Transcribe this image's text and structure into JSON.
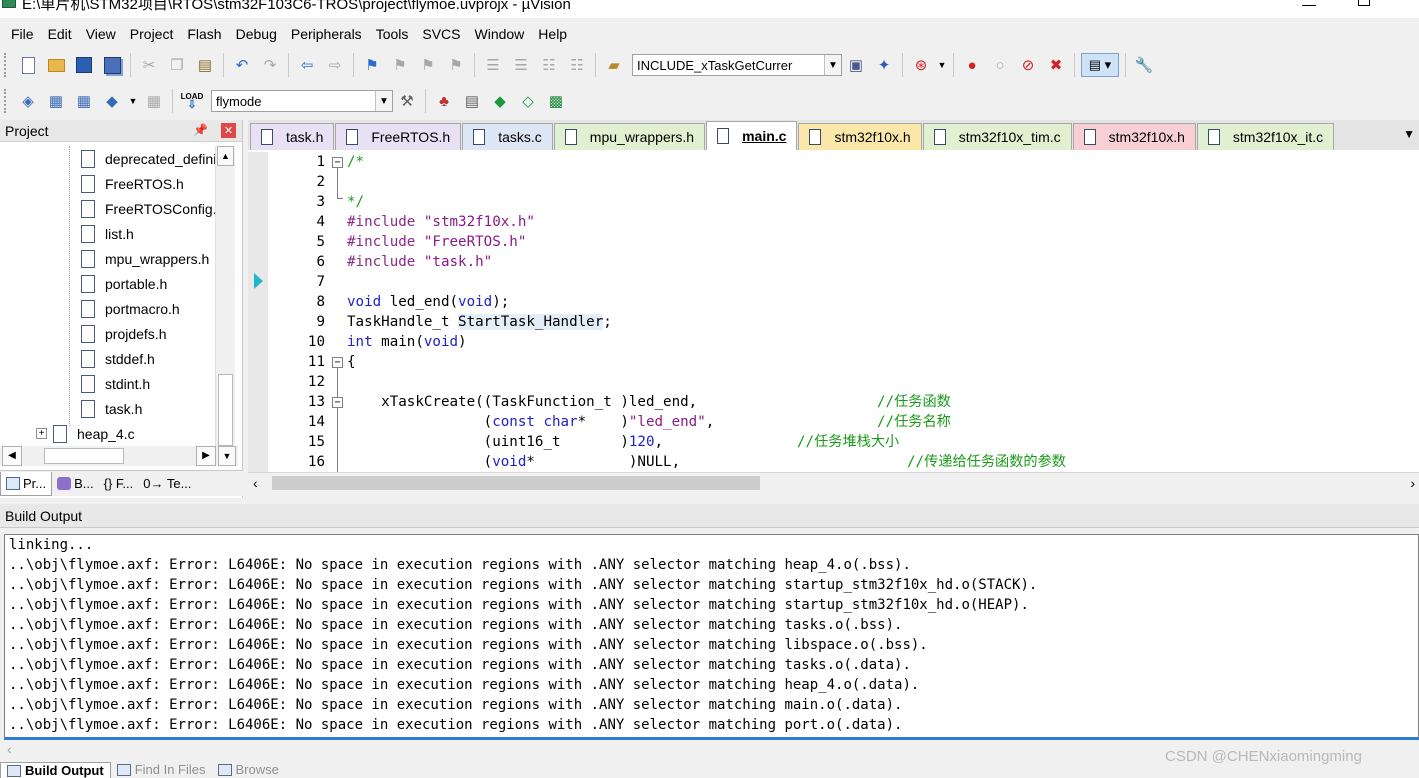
{
  "window": {
    "title": "E:\\单片机\\STM32项目\\RTOS\\stm32F103C6-TROS\\project\\flymoe.uvprojx - µVision"
  },
  "menu": [
    "File",
    "Edit",
    "View",
    "Project",
    "Flash",
    "Debug",
    "Peripherals",
    "Tools",
    "SVCS",
    "Window",
    "Help"
  ],
  "toolbar": {
    "find_value": "INCLUDE_xTaskGetCurrer",
    "target_value": "flymode",
    "load_label": "LOAD"
  },
  "project_panel": {
    "title": "Project",
    "tree": [
      "deprecated_definitions.h",
      "FreeRTOS.h",
      "FreeRTOSConfig.h",
      "list.h",
      "mpu_wrappers.h",
      "portable.h",
      "portmacro.h",
      "projdefs.h",
      "stddef.h",
      "stdint.h",
      "task.h"
    ],
    "group_item": "heap_4.c",
    "group_expander": "+",
    "tabs": [
      "Pr...",
      "B...",
      "{} F...",
      "0→ Te..."
    ]
  },
  "editor": {
    "tabs": [
      {
        "label": "task.h",
        "color": "#e8e0f4"
      },
      {
        "label": "FreeRTOS.h",
        "color": "#e8e0f4"
      },
      {
        "label": "tasks.c",
        "color": "#dde6f4"
      },
      {
        "label": "mpu_wrappers.h",
        "color": "#e0f0d0"
      },
      {
        "label": "main.c",
        "color": "#ffffff"
      },
      {
        "label": "stm32f10x.h",
        "color": "#fbe8a8"
      },
      {
        "label": "stm32f10x_tim.c",
        "color": "#e0f0d0"
      },
      {
        "label": "stm32f10x.h",
        "color": "#f8d0d4"
      },
      {
        "label": "stm32f10x_it.c",
        "color": "#e0f0d0"
      }
    ],
    "active_tab_index": 4,
    "line_numbers": [
      "1",
      "2",
      "3",
      "4",
      "5",
      "6",
      "7",
      "8",
      "9",
      "10",
      "11",
      "12",
      "13",
      "14",
      "15",
      "16"
    ],
    "lines": {
      "l1": "/*",
      "l3": "*/",
      "l4_pp": "#include",
      "l4_str": "\"stm32f10x.h\"",
      "l5_pp": "#include",
      "l5_str": "\"FreeRTOS.h\"",
      "l6_pp": "#include",
      "l6_str": "\"task.h\"",
      "l8_kw": "void",
      "l8_a": " led_end(",
      "l8_kw2": "void",
      "l8_b": ");",
      "l9_a": "TaskHandle_t ",
      "l9_hl": "StartTask_Handler",
      "l9_b": ";",
      "l10_kw": "int",
      "l10_a": " main(",
      "l10_kw2": "void",
      "l10_b": ")",
      "l11": "{",
      "l13_a": "    xTaskCreate((TaskFunction_t )led_end,",
      "l13_cm": "//任务函数",
      "l14_a": "                (",
      "l14_kw": "const char",
      "l14_b": "*    )",
      "l14_str": "\"led_end\"",
      "l14_c": ",",
      "l14_cm": "//任务名称",
      "l15_a": "                (uint16_t       )",
      "l15_num": "120",
      "l15_b": ",",
      "l15_cm": "//任务堆栈大小",
      "l16_a": "                (",
      "l16_kw": "void",
      "l16_b": "*           )NULL,",
      "l16_cm": "//传递给任务函数的参数"
    }
  },
  "build_output": {
    "title": "Build Output",
    "lines": [
      "linking...",
      "..\\obj\\flymoe.axf: Error: L6406E: No space in execution regions with .ANY selector matching heap_4.o(.bss).",
      "..\\obj\\flymoe.axf: Error: L6406E: No space in execution regions with .ANY selector matching startup_stm32f10x_hd.o(STACK).",
      "..\\obj\\flymoe.axf: Error: L6406E: No space in execution regions with .ANY selector matching startup_stm32f10x_hd.o(HEAP).",
      "..\\obj\\flymoe.axf: Error: L6406E: No space in execution regions with .ANY selector matching tasks.o(.bss).",
      "..\\obj\\flymoe.axf: Error: L6406E: No space in execution regions with .ANY selector matching libspace.o(.bss).",
      "..\\obj\\flymoe.axf: Error: L6406E: No space in execution regions with .ANY selector matching tasks.o(.data).",
      "..\\obj\\flymoe.axf: Error: L6406E: No space in execution regions with .ANY selector matching heap_4.o(.data).",
      "..\\obj\\flymoe.axf: Error: L6406E: No space in execution regions with .ANY selector matching main.o(.data).",
      "..\\obj\\flymoe.axf: Error: L6406E: No space in execution regions with .ANY selector matching port.o(.data)."
    ],
    "tabs": [
      "Build Output",
      "Find In Files",
      "Browse"
    ]
  },
  "watermark": "CSDN @CHENxiaomingming",
  "colors": {
    "accent": "#2a7fd4",
    "cursor_marker": "#1fb8c8",
    "keyword": "#2020c8",
    "comment": "#1a9a1a",
    "string": "#8a1a8a"
  }
}
